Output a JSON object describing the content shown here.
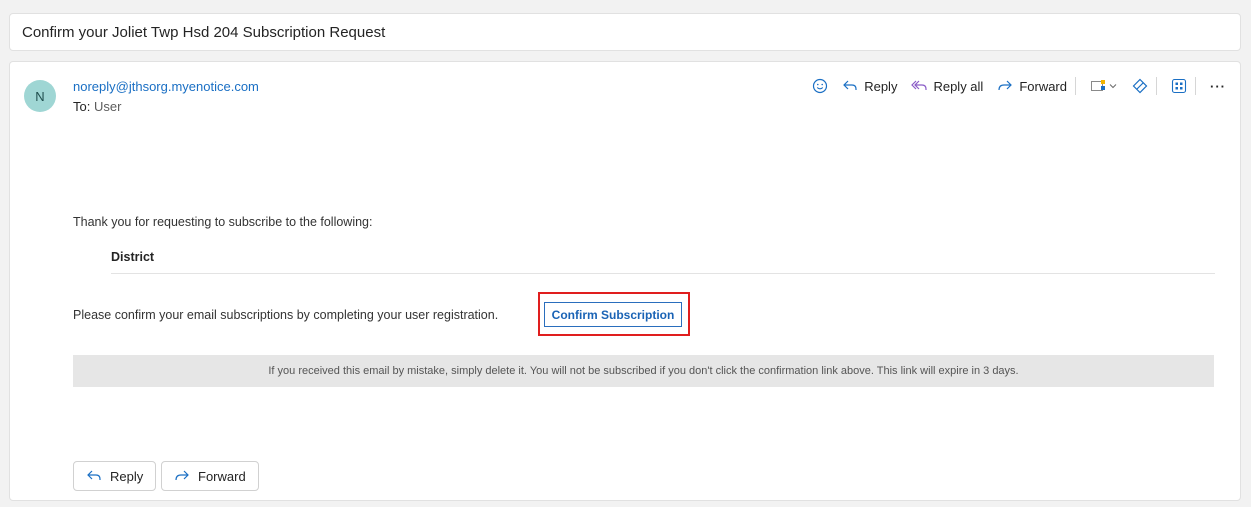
{
  "subject": "Confirm your Joliet Twp Hsd 204 Subscription Request",
  "message": {
    "avatar_initial": "N",
    "sender": "noreply@jthsorg.myenotice.com",
    "to_label": "To:",
    "recipient": "User"
  },
  "toolbar": {
    "reply": "Reply",
    "reply_all": "Reply all",
    "forward": "Forward",
    "more": "···"
  },
  "body": {
    "intro": "Thank you for requesting to subscribe to the following:",
    "district": "District",
    "confirm_prompt": "Please confirm your email subscriptions by completing your user registration.",
    "confirm_button": "Confirm Subscription",
    "notice": "If you received this email by mistake, simply delete it. You will not be subscribed if you don't click the confirmation link above. This link will expire in 3 days."
  },
  "footer": {
    "reply": "Reply",
    "forward": "Forward"
  },
  "colors": {
    "accent": "#1a6fc4",
    "reply_all_icon": "#8a5cc7",
    "highlight": "#e01e1e"
  }
}
